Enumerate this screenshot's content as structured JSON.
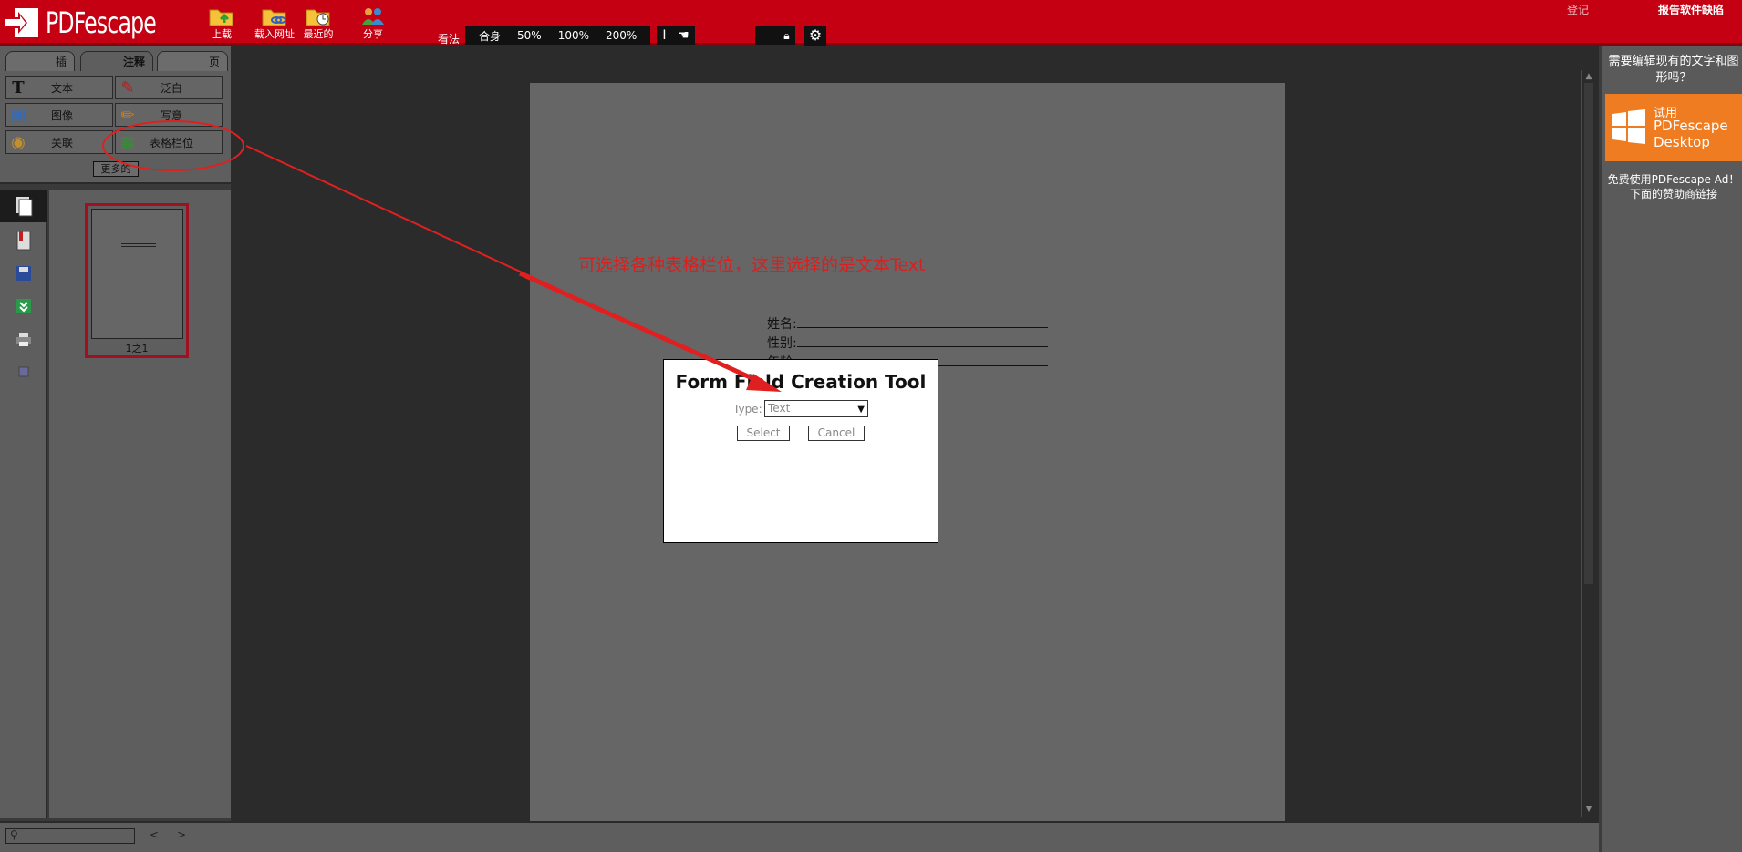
{
  "app": {
    "logo_text": "PDFescape",
    "brand_color": "#c40012"
  },
  "toolbar": {
    "upload_label": "上载",
    "load_url_label": "载入网址",
    "recent_label": "最近的",
    "share_label": "分享",
    "view_label": "看法",
    "zoom_options": [
      "合身",
      "50%",
      "100%",
      "200%"
    ],
    "login_label": "登记",
    "report_label": "报告软件缺陷"
  },
  "left_panel": {
    "tabs": [
      "插",
      "注释",
      "页"
    ],
    "tools": [
      {
        "label": "文本",
        "icon": "text-icon"
      },
      {
        "label": "泛白",
        "icon": "whiteout-icon"
      },
      {
        "label": "图像",
        "icon": "image-icon"
      },
      {
        "label": "写意",
        "icon": "freehand-icon"
      },
      {
        "label": "关联",
        "icon": "link-icon"
      },
      {
        "label": "表格栏位",
        "icon": "form-field-icon"
      }
    ],
    "more_label": "更多的",
    "thumbnail_label": "1之1"
  },
  "document": {
    "form_lines": [
      "姓名:",
      "性别:",
      "年龄:"
    ],
    "annotation_text": "可选择各种表格栏位，这里选择的是文本Text",
    "annotation_color": "#d92020"
  },
  "dialog": {
    "title": "Form Field Creation Tool",
    "type_label": "Type:",
    "type_value": "Text",
    "select_label": "Select",
    "cancel_label": "Cancel"
  },
  "right_panel": {
    "question": "需要编辑现有的文字和图形吗？",
    "promo_try": "试用",
    "promo_product": "PDFescape Desktop",
    "promo_color": "#f07c22",
    "free_text": "免费使用PDFescape Ad！下面的赞助商链接"
  }
}
